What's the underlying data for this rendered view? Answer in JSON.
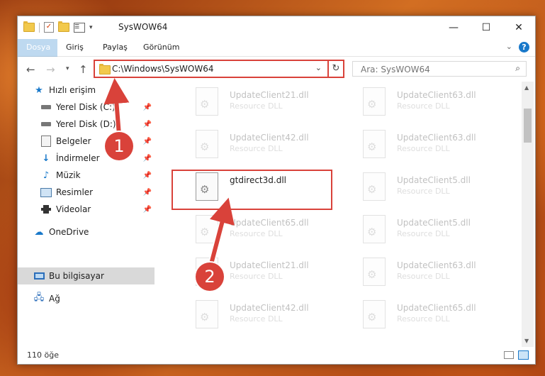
{
  "window": {
    "title": "SysWOW64",
    "controls": {
      "minimize": "—",
      "maximize": "☐",
      "close": "✕"
    }
  },
  "ribbon": {
    "tabs": [
      "Dosya",
      "Giriş",
      "Paylaş",
      "Görünüm"
    ],
    "help": "?"
  },
  "nav": {
    "address": "C:\\Windows\\SysWOW64",
    "search_placeholder": "Ara: SysWOW64"
  },
  "sidebar": {
    "items": [
      {
        "label": "Hızlı erişim",
        "icon": "star-icon"
      },
      {
        "label": "Yerel Disk (C:)",
        "icon": "drive-icon",
        "pinned": true
      },
      {
        "label": "Yerel Disk (D:)",
        "icon": "drive-icon",
        "pinned": true
      },
      {
        "label": "Belgeler",
        "icon": "documents-icon",
        "pinned": true
      },
      {
        "label": "İndirmeler",
        "icon": "download-icon",
        "pinned": true
      },
      {
        "label": "Müzik",
        "icon": "music-icon",
        "pinned": true
      },
      {
        "label": "Resimler",
        "icon": "pictures-icon",
        "pinned": true
      },
      {
        "label": "Videolar",
        "icon": "videos-icon",
        "pinned": true
      },
      {
        "label": "OneDrive",
        "icon": "cloud-icon"
      },
      {
        "label": "Bu bilgisayar",
        "icon": "computer-icon",
        "selected": true
      },
      {
        "label": "Ağ",
        "icon": "network-icon"
      }
    ]
  },
  "files": {
    "left": [
      {
        "name": "UpdateClient21.dll",
        "desc": "Resource DLL"
      },
      {
        "name": "UpdateClient42.dll",
        "desc": "Resource DLL"
      },
      {
        "name": "gtdirect3d.dll",
        "desc": "",
        "highlighted": true
      },
      {
        "name": "UpdateClient65.dll",
        "desc": "Resource DLL"
      },
      {
        "name": "UpdateClient21.dll",
        "desc": "Resource DLL"
      },
      {
        "name": "UpdateClient42.dll",
        "desc": "Resource DLL"
      }
    ],
    "right": [
      {
        "name": "UpdateClient63.dll",
        "desc": "Resource DLL"
      },
      {
        "name": "UpdateClient63.dll",
        "desc": "Resource DLL"
      },
      {
        "name": "UpdateClient5.dll",
        "desc": "Resource DLL"
      },
      {
        "name": "UpdateClient5.dll",
        "desc": "Resource DLL"
      },
      {
        "name": "UpdateClient63.dll",
        "desc": "Resource DLL"
      },
      {
        "name": "UpdateClient65.dll",
        "desc": "Resource DLL"
      }
    ]
  },
  "status": {
    "item_count": "110 öğe"
  },
  "annotations": {
    "step1": "1",
    "step2": "2",
    "color": "#d9423a"
  }
}
